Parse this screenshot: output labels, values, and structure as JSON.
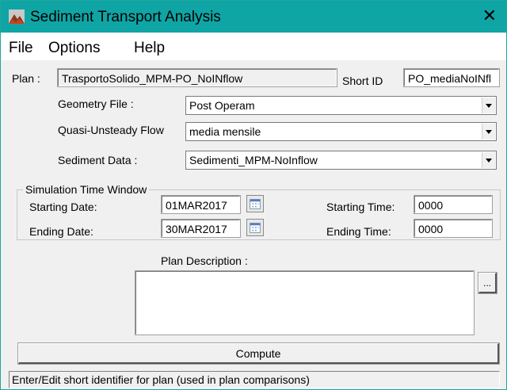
{
  "window": {
    "title": "Sediment Transport Analysis",
    "close_glyph": "✕"
  },
  "menu": {
    "items": [
      "File",
      "Options",
      "Help"
    ]
  },
  "plan": {
    "label": "Plan :",
    "value": "TrasportoSolido_MPM-PO_NoINflow",
    "short_id_label": "Short ID",
    "short_id_value": "PO_mediaNoINfl"
  },
  "geometry": {
    "label": "Geometry File :",
    "value": "Post Operam"
  },
  "flow": {
    "label": "Quasi-Unsteady Flow",
    "value": "media mensile"
  },
  "sediment": {
    "label": "Sediment Data :",
    "value": "Sedimenti_MPM-NoInflow"
  },
  "time_window": {
    "title": "Simulation Time Window",
    "starting_date_label": "Starting Date:",
    "starting_date": "01MAR2017",
    "ending_date_label": "Ending Date:",
    "ending_date": "30MAR2017",
    "starting_time_label": "Starting Time:",
    "starting_time": "0000",
    "ending_time_label": "Ending Time:",
    "ending_time": "0000"
  },
  "description": {
    "label": "Plan Description :",
    "value": "",
    "more_button": "..."
  },
  "compute_button": "Compute",
  "status": "Enter/Edit short identifier for plan (used in plan comparisons)",
  "colors": {
    "titlebar": "#0fa5a5",
    "window_bg": "#f0f0f0"
  },
  "icons": {
    "app": "hec-ras-icon",
    "calendar": "calendar-icon",
    "dropdown": "chevron-down-icon"
  }
}
